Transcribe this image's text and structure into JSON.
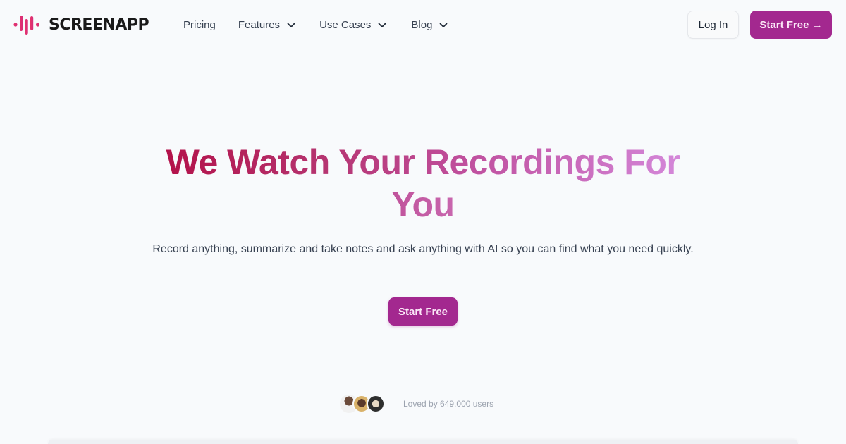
{
  "header": {
    "logo_text": "SCREENAPP",
    "nav": [
      {
        "label": "Pricing",
        "has_dropdown": false
      },
      {
        "label": "Features",
        "has_dropdown": true
      },
      {
        "label": "Use Cases",
        "has_dropdown": true
      },
      {
        "label": "Blog",
        "has_dropdown": true
      }
    ],
    "login_label": "Log In",
    "start_free_label": "Start Free →"
  },
  "hero": {
    "title_line1": "We Watch Your Recordings For",
    "title_line2": "You",
    "subtitle": {
      "link1": "Record anything",
      "sep1": ", ",
      "link2": "summarize",
      "sep2": " and ",
      "link3": "take notes",
      "sep3": " and ",
      "link4": "ask anything with AI",
      "tail": " so you can find what you need quickly."
    },
    "cta_label": "Start Free"
  },
  "social_proof": {
    "text": "Loved by 649,000 users",
    "avatar_count": 3
  },
  "colors": {
    "brand": "#a3288f",
    "logo_accent": "#e0336b",
    "title_gradient_start": "#b3124a",
    "title_gradient_end": "#d487d9",
    "background": "#f8fafc"
  }
}
